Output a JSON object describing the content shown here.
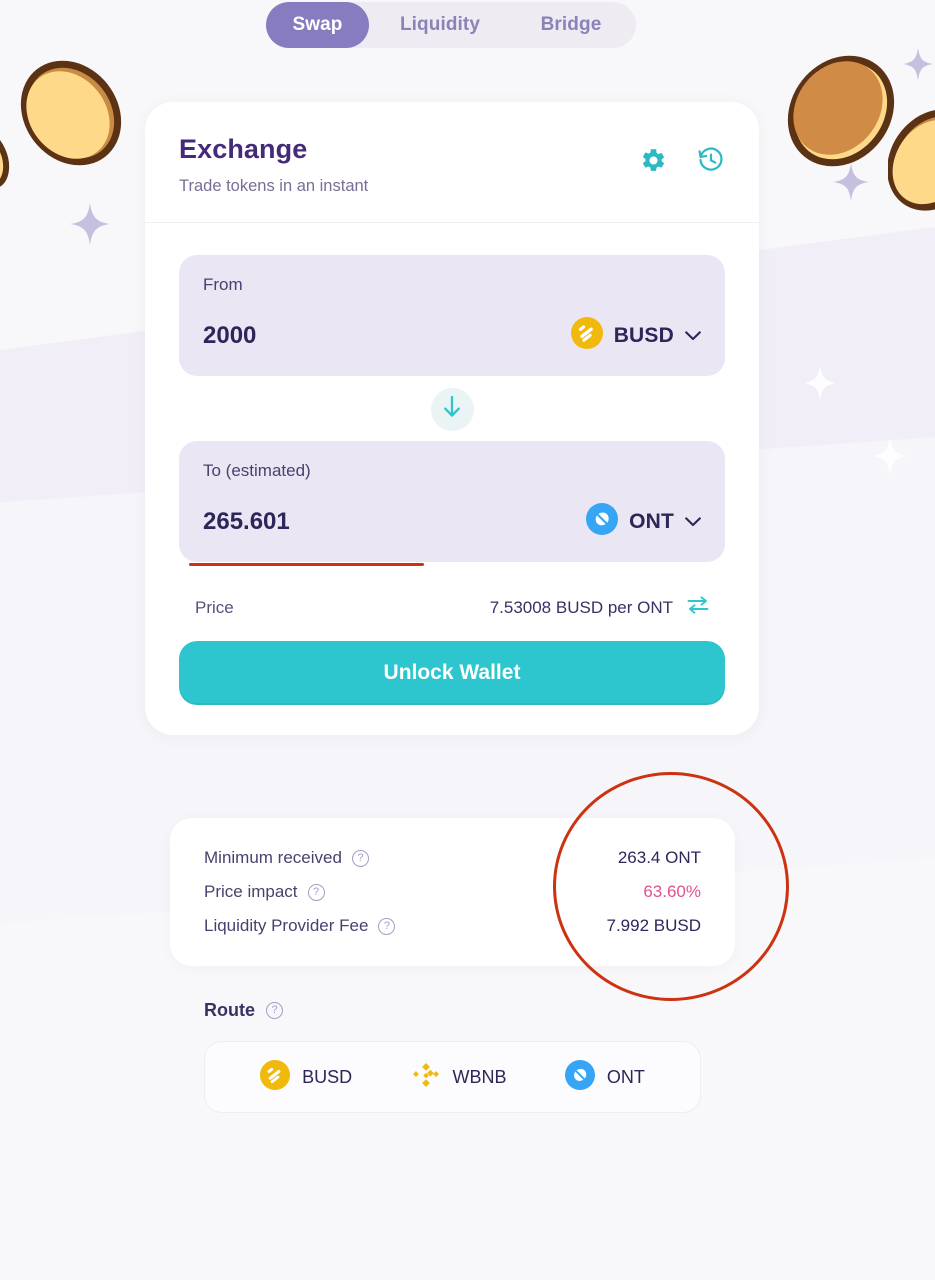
{
  "theme": {
    "page_bg": "#f8f7f9",
    "accent_teal": "#2ec6ce",
    "accent_purple": "#867cbf",
    "title_purple": "#452a7a",
    "panel_bg": "#eae6f4",
    "annotation_red": "#cc3311",
    "impact_pink": "#e1508f",
    "busd_gold": "#f0b90b",
    "ont_blue": "#36a5f5"
  },
  "tabs": [
    {
      "id": "swap",
      "label": "Swap",
      "active": true
    },
    {
      "id": "liquidity",
      "label": "Liquidity",
      "active": false
    },
    {
      "id": "bridge",
      "label": "Bridge",
      "active": false
    }
  ],
  "exchange": {
    "title": "Exchange",
    "subtitle": "Trade tokens in an instant",
    "icons": {
      "settings": "gear-icon",
      "history": "history-icon"
    },
    "from": {
      "label": "From",
      "amount": "2000",
      "placeholder": "0.0",
      "token": "BUSD",
      "token_icon": "busd-icon"
    },
    "swap_direction_icon": "arrow-down-icon",
    "to": {
      "label": "To (estimated)",
      "amount": "265.601",
      "placeholder": "0.0",
      "token": "ONT",
      "token_icon": "ont-icon",
      "underlined": true
    },
    "price": {
      "label": "Price",
      "value": "7.53008 BUSD per ONT",
      "toggle_icon": "swap-arrows-icon"
    },
    "cta_label": "Unlock Wallet"
  },
  "details": [
    {
      "label": "Minimum received",
      "value": "263.4 ONT",
      "highlight": false
    },
    {
      "label": "Price impact",
      "value": "63.60%",
      "highlight": true
    },
    {
      "label": "Liquidity Provider Fee",
      "value": "7.992 BUSD",
      "highlight": false
    }
  ],
  "route": {
    "title": "Route",
    "steps": [
      {
        "name": "BUSD",
        "icon": "busd-icon"
      },
      {
        "name": "WBNB",
        "icon": "wbnb-icon"
      },
      {
        "name": "ONT",
        "icon": "ont-icon"
      }
    ]
  },
  "annotations": {
    "circle": {
      "target": "details-values-column",
      "color": "#cc3311"
    },
    "underline": {
      "target": "to-amount",
      "color": "#cc3311"
    }
  }
}
